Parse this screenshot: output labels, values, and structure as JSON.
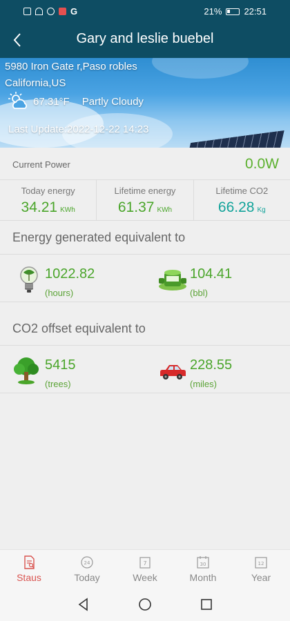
{
  "status_bar": {
    "battery": "21%",
    "time": "22:51"
  },
  "header": {
    "title": "Gary and leslie buebel"
  },
  "site": {
    "address_line1": "5980 Iron Gate r,Paso robles",
    "address_line2": "California,US",
    "weather_icon": "partly-cloudy-icon",
    "temperature": "67.31°F",
    "condition": "Partly Cloudy",
    "last_update": "Last Update:2022-12-22 14:23"
  },
  "current_power": {
    "label": "Current Power",
    "value": "0.0W"
  },
  "energy": {
    "today": {
      "label": "Today energy",
      "value": "34.21",
      "unit": "KWh"
    },
    "lifetime": {
      "label": "Lifetime energy",
      "value": "61.37",
      "unit": "KWh"
    },
    "co2": {
      "label": "Lifetime CO2",
      "value": "66.28",
      "unit": "Kg"
    }
  },
  "energy_equivalent": {
    "title": "Energy generated equivalent to",
    "bulb": {
      "value": "1022.82",
      "unit": "(hours)",
      "icon": "light-bulb-icon"
    },
    "oil": {
      "value": "104.41",
      "unit": "(bbl)",
      "icon": "oil-barrel-icon"
    }
  },
  "co2_offset": {
    "title": "CO2 offset equivalent to",
    "trees": {
      "value": "5415",
      "unit": "(trees)",
      "icon": "tree-icon"
    },
    "miles": {
      "value": "228.55",
      "unit": "(miles)",
      "icon": "car-icon"
    }
  },
  "tabs": [
    {
      "label": "Staus",
      "icon": "status-report-icon",
      "active": true
    },
    {
      "label": "Today",
      "icon": "today-calendar-icon",
      "day": "24"
    },
    {
      "label": "Week",
      "icon": "week-calendar-icon",
      "day": "7"
    },
    {
      "label": "Month",
      "icon": "month-calendar-icon",
      "day": "30"
    },
    {
      "label": "Year",
      "icon": "year-calendar-icon",
      "day": "12"
    }
  ],
  "colors": {
    "header": "#0e4d63",
    "value_green": "#4aa52a",
    "co2_teal": "#12a39a",
    "active_tab": "#d9534f"
  }
}
